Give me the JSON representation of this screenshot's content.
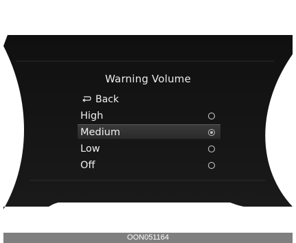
{
  "screen": {
    "title": "Warning Volume",
    "back_label": "Back",
    "back_icon": "return-arrow-icon",
    "options": [
      {
        "label": "High",
        "selected": false
      },
      {
        "label": "Medium",
        "selected": true
      },
      {
        "label": "Low",
        "selected": false
      },
      {
        "label": "Off",
        "selected": false
      }
    ]
  },
  "caption": "OON051164",
  "colors": {
    "display_bg": "#141414",
    "text": "#f0f0f0",
    "caption_bar": "#7f7f7f"
  }
}
